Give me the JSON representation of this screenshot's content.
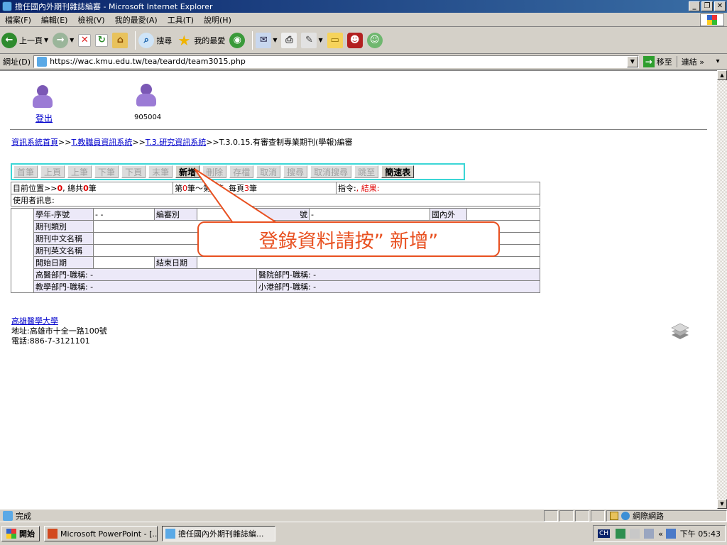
{
  "window": {
    "title": "擔任國內外期刊雜誌編審 - Microsoft Internet Explorer"
  },
  "menu": [
    "檔案(F)",
    "編輯(E)",
    "檢視(V)",
    "我的最愛(A)",
    "工具(T)",
    "說明(H)"
  ],
  "toolbar": {
    "back": "上一頁",
    "search": "搜尋",
    "favorites": "我的最愛"
  },
  "address": {
    "label": "網址(D)",
    "url": "https://wac.kmu.edu.tw/tea/teardd/team3015.php",
    "go": "移至",
    "links": "連結"
  },
  "page": {
    "logout": "登出",
    "user_id": "905004",
    "breadcrumb": {
      "home": "資訊系統首頁",
      "sep1": ">>",
      "staff": "T.教職員資訊系統",
      "sep2": ">>",
      "research": "T.3.研究資訊系統",
      "current": ">>T.3.0.15.有審查制專業期刊(學報)編審"
    },
    "buttons": [
      {
        "label": "首筆",
        "enabled": false
      },
      {
        "label": "上頁",
        "enabled": false
      },
      {
        "label": "上筆",
        "enabled": false
      },
      {
        "label": "下筆",
        "enabled": false
      },
      {
        "label": "下頁",
        "enabled": false
      },
      {
        "label": "末筆",
        "enabled": false
      },
      {
        "label": "新增",
        "enabled": true
      },
      {
        "label": "刪除",
        "enabled": false
      },
      {
        "label": "存檔",
        "enabled": false
      },
      {
        "label": "取消",
        "enabled": false
      },
      {
        "label": "搜尋",
        "enabled": false
      },
      {
        "label": "取消搜尋",
        "enabled": false
      },
      {
        "label": "跳至",
        "enabled": false
      },
      {
        "label": "簡速表",
        "enabled": true
      }
    ],
    "status": {
      "position_label": "目前位置>>",
      "position_value": "0",
      "total_label": ", 總共",
      "total_value": "0",
      "total_unit": "筆",
      "range_prefix": "第",
      "range_start": "0",
      "range_mid": "筆～第",
      "range_end": "0",
      "range_suffix": "筆, 每頁",
      "per_page": "3",
      "per_page_unit": "筆",
      "command_label": "指令:",
      "result_label": ", 結果:",
      "message_label": "使用者訊息:"
    },
    "fields": {
      "year_seq_label": "學年-序號",
      "year_seq_value": "- -",
      "review_type_label": "編審別",
      "issn_label": "號",
      "issn_value": "-",
      "domestic_label": "國內外",
      "journal_type_label": "期刊類別",
      "journal_cn_label": "期刊中文名稱",
      "journal_en_label": "期刊英文名稱",
      "start_date_label": "開始日期",
      "end_date_label": "結束日期",
      "medical_dept_label": "高醫部門-職稱: -",
      "hospital_dept_label": "醫院部門-職稱: -",
      "teaching_dept_label": "教學部門-職稱: -",
      "xiaogang_dept_label": "小港部門-職稱: -"
    },
    "callout": "登錄資料請按” 新增”",
    "footer": {
      "name": "高雄醫學大學",
      "address": "地址:高雄市十全一路100號",
      "phone": "電話:886-7-3121101"
    }
  },
  "statusbar": {
    "text": "完成",
    "zone": "網際網路"
  },
  "taskbar": {
    "start": "開始",
    "tasks": [
      "Microsoft PowerPoint - [...",
      "擔任國內外期刊雜誌編..."
    ],
    "ime": "CH",
    "clock": "下午 05:43"
  },
  "colors": {
    "accent_red": "#e00000",
    "callout": "#e85020",
    "button_border": "#3bd6d6",
    "title_bar": "#0a246a",
    "link": "#0000cc"
  }
}
